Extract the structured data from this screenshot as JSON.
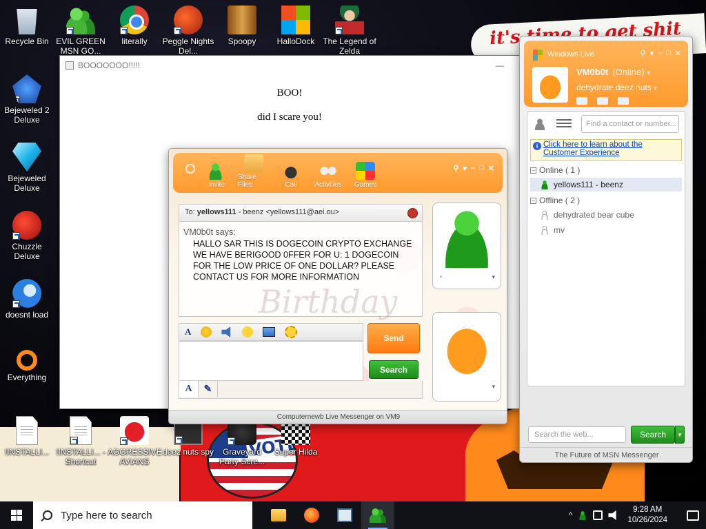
{
  "wallpaper": {
    "banner_text": "it's time to get shit",
    "flag_text": "VOTE"
  },
  "desktop_icons": [
    {
      "label": "Recycle Bin",
      "icon": "recycle-bin-icon"
    },
    {
      "label": "EVIL GREEN MSN GO...",
      "icon": "msn-buddies-icon"
    },
    {
      "label": "literally",
      "icon": "chrome-icon"
    },
    {
      "label": "Peggle Nights Del...",
      "icon": "peggle-icon"
    },
    {
      "label": "Spoopy",
      "icon": "spoopy-icon"
    },
    {
      "label": "HalloDock",
      "icon": "windows-logo-icon"
    },
    {
      "label": "The Legend of Zelda",
      "icon": "legend-icon"
    },
    {
      "label": "Bejeweled 2 Deluxe",
      "icon": "bejeweled2-icon"
    },
    {
      "label": "Bejeweled Deluxe",
      "icon": "gem-icon"
    },
    {
      "label": "Chuzzle Deluxe",
      "icon": "chuzzle-icon"
    },
    {
      "label": "doesnt load",
      "icon": "thunderbird-icon"
    },
    {
      "label": "Everything",
      "icon": "everything-search-icon"
    },
    {
      "label": "!INSTALLI...",
      "icon": "document-icon"
    },
    {
      "label": "!INSTALLI... - Shortcut",
      "icon": "document-icon"
    },
    {
      "label": "AGGRESSIVE AVIANS",
      "icon": "angry-bird-icon"
    },
    {
      "label": "deez nuts spy",
      "icon": "deez-nuts-icon"
    },
    {
      "label": "Graveyard Party Scre...",
      "icon": "graveyard-icon"
    },
    {
      "label": "Super Hilda",
      "icon": "super-hilda-icon"
    }
  ],
  "boo_window": {
    "title": "BOOOOOOO!!!!!",
    "line1": "BOO!",
    "line2": "did I scare you!",
    "minimize_label": "—"
  },
  "conversation": {
    "toolbar": [
      {
        "label": "Invite",
        "icon": "invite-icon"
      },
      {
        "label": "Share Files",
        "icon": "share-files-icon"
      },
      {
        "label": "Call",
        "icon": "call-icon"
      },
      {
        "label": "Activities",
        "icon": "activities-icon"
      },
      {
        "label": "Games",
        "icon": "games-icon"
      }
    ],
    "to_prefix": "To:",
    "to_name": "yellows111",
    "to_detail": " - beenz <yellows111@aei.ou>",
    "sender": "VM0b0t says:",
    "message": "HALLO SAR THIS IS DOGECOIN CRYPTO EXCHANGE WE HAVE BERIGOOD 0FFER FOR U: 1 DOGECOIN FOR THE LOW PRICE OF ONE DOLLAR? PLEASE CONTACT US FOR MORE INFORMATION",
    "theme_watermark": "Birthday",
    "send_label": "Send",
    "search_label": "Search",
    "statusbar": "Computernewb Live Messenger on VM9"
  },
  "contact_list": {
    "title": "Windows Live",
    "username": "VM0b0t",
    "status": "(Online)",
    "personal_message": "dehydrate deez nuts",
    "find_placeholder": "Find a contact or number...",
    "banner_line1": "Click here to learn about the",
    "banner_line2": "Customer Experience",
    "online_group": "Online ( 1 )",
    "offline_group": "Offline ( 2 )",
    "online_contacts": [
      "yellows111 - beenz"
    ],
    "offline_contacts": [
      "dehydrated bear cube",
      "mv"
    ],
    "web_search_placeholder": "Search the web...",
    "search_label": "Search",
    "footer": "The Future of MSN Messenger"
  },
  "taskbar": {
    "search_placeholder": "Type here to search",
    "apps": [
      "file-explorer-icon",
      "firefox-icon",
      "notepad-icon",
      "msn-messenger-icon"
    ],
    "time": "9:28 AM",
    "date": "10/26/2024"
  }
}
